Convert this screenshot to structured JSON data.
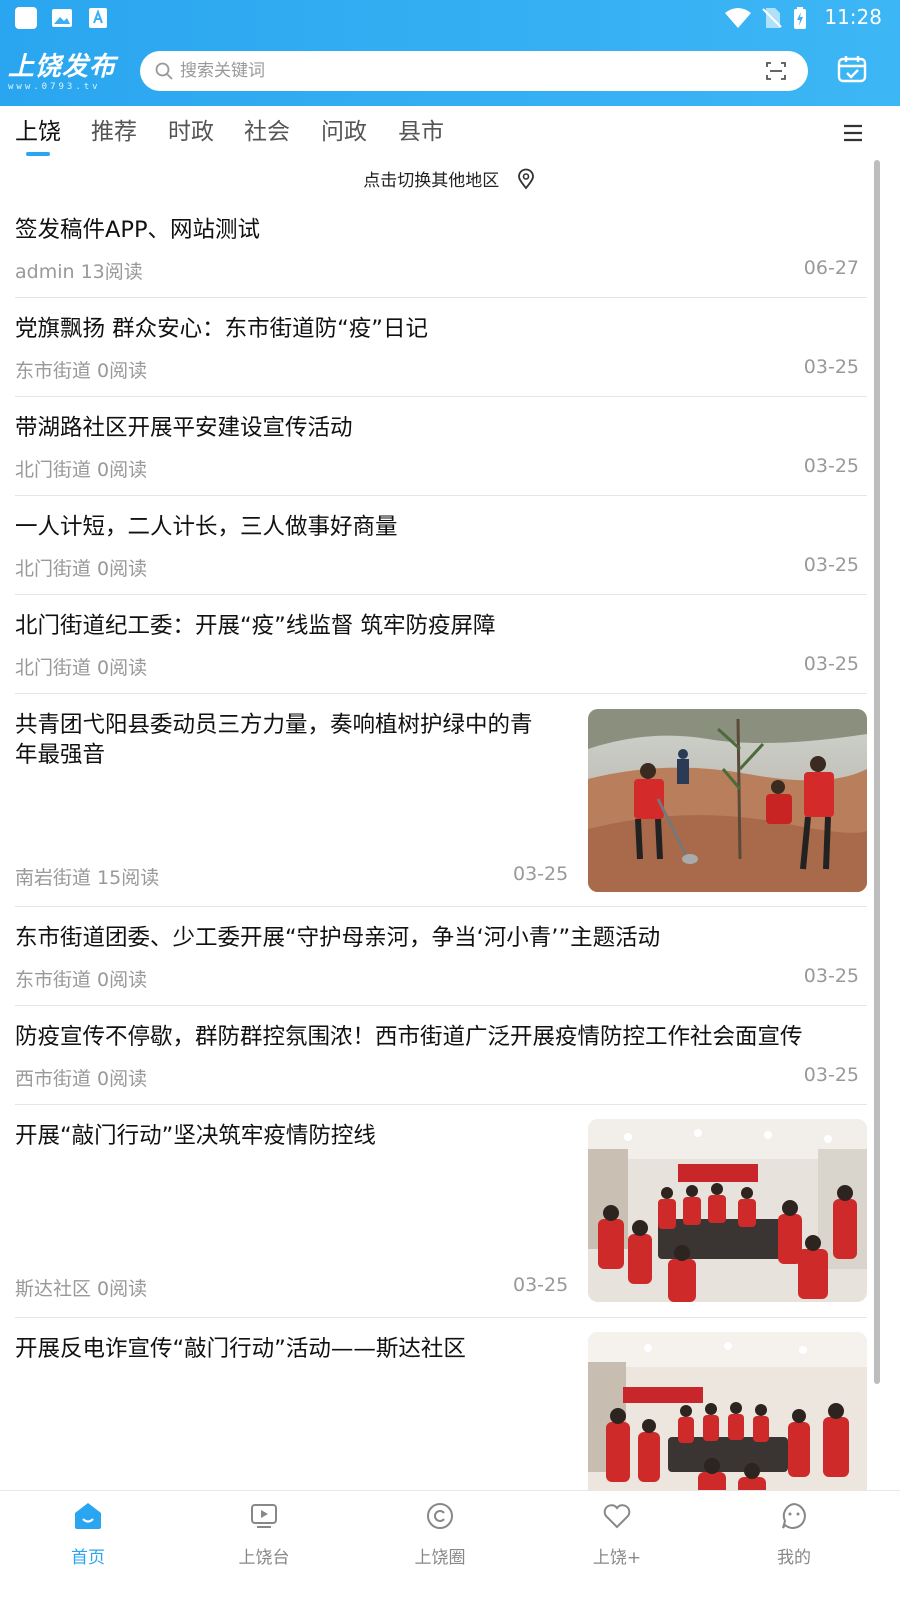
{
  "status_bar": {
    "time": "11:28"
  },
  "header": {
    "logo_text": "上饶发布",
    "logo_sub": "www.0793.tv",
    "search_placeholder": "搜索关键词"
  },
  "tabs": [
    {
      "label": "上饶",
      "active": true
    },
    {
      "label": "推荐"
    },
    {
      "label": "时政"
    },
    {
      "label": "社会"
    },
    {
      "label": "问政"
    },
    {
      "label": "县市"
    }
  ],
  "region_switch": {
    "label": "点击切换其他地区"
  },
  "news": [
    {
      "title": "签发稿件APP、网站测试",
      "meta": "admin 13阅读",
      "date": "06-27"
    },
    {
      "title": "党旗飘扬 群众安心：东市街道防“疫”日记",
      "meta": "东市街道 0阅读",
      "date": "03-25"
    },
    {
      "title": "带湖路社区开展平安建设宣传活动",
      "meta": "北门街道 0阅读",
      "date": "03-25"
    },
    {
      "title": "一人计短，二人计长，三人做事好商量",
      "meta": "北门街道 0阅读",
      "date": "03-25"
    },
    {
      "title": "北门街道纪工委：开展“疫”线监督 筑牢防疫屏障",
      "meta": "北门街道 0阅读",
      "date": "03-25"
    },
    {
      "title_line1": "共青团弋阳县委动员三方力量，奏响植树护绿中的青",
      "title_line2": "年最强音",
      "meta": "南岩街道 15阅读",
      "date": "03-25",
      "image": "tree-planting-photo"
    },
    {
      "title": "东市街道团委、少工委开展“守护母亲河，争当‘河小青’”主题活动",
      "meta": "东市街道 0阅读",
      "date": "03-25"
    },
    {
      "title": "防疫宣传不停歇，群防群控氛围浓！西市街道广泛开展疫情防控工作社会面宣传",
      "meta": "西市街道 0阅读",
      "date": "03-25"
    },
    {
      "title": "开展“敲门行动”坚决筑牢疫情防控线",
      "meta": "斯达社区 0阅读",
      "date": "03-25",
      "image": "meeting-room-photo"
    },
    {
      "title": "开展反电诈宣传“敲门行动”活动——斯达社区",
      "image": "meeting-room-photo-2"
    }
  ],
  "bottom_nav": [
    {
      "label": "首页",
      "icon": "home-icon",
      "active": true
    },
    {
      "label": "上饶台",
      "icon": "tv-play-icon"
    },
    {
      "label": "上饶圈",
      "icon": "circle-icon"
    },
    {
      "label": "上饶+",
      "icon": "heart-icon"
    },
    {
      "label": "我的",
      "icon": "profile-icon"
    }
  ],
  "colors": {
    "accent": "#2aa6f0",
    "text": "#111111",
    "meta": "#999999"
  }
}
